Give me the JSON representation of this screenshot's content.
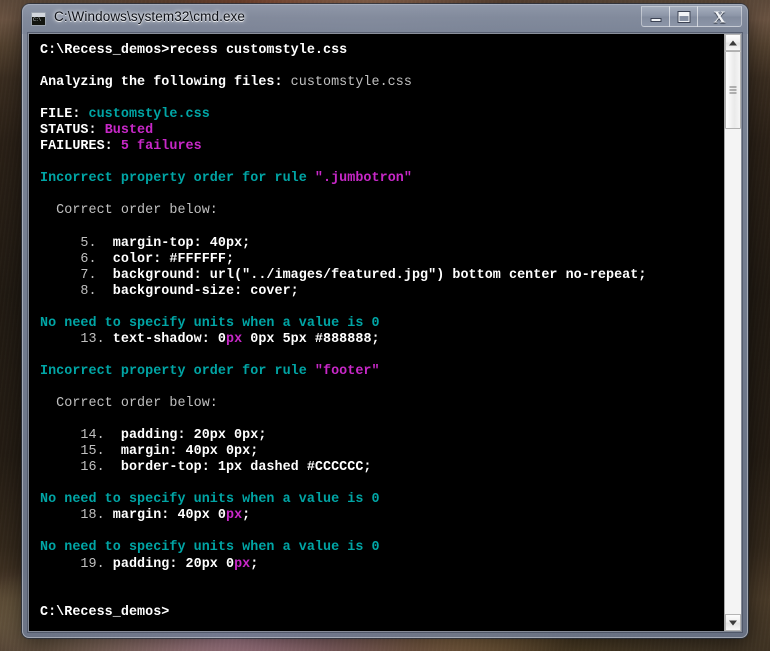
{
  "desktop": {
    "wallpaper_alt": "blurred photograph wallpaper"
  },
  "window": {
    "title": "C:\\Windows\\system32\\cmd.exe",
    "icon_name": "cmd-console-icon",
    "icon_label": "C:\\",
    "buttons": {
      "minimize": "Minimize",
      "maximize": "Maximize",
      "close": "Close"
    }
  },
  "scrollbar": {
    "up_arrow": "Scroll up",
    "down_arrow": "Scroll down",
    "thumb": "Scroll thumb"
  },
  "console": {
    "lines": [
      {
        "id": "prompt-1",
        "segments": [
          {
            "text": "C:\\Recess_demos>recess customstyle.css",
            "color": "white"
          }
        ]
      },
      {
        "id": "blank-1",
        "segments": [
          {
            "text": "",
            "color": "white"
          }
        ]
      },
      {
        "id": "analyzing",
        "segments": [
          {
            "text": "Analyzing the following files: ",
            "color": "white"
          },
          {
            "text": "customstyle.css",
            "color": "gray"
          }
        ]
      },
      {
        "id": "blank-2",
        "segments": [
          {
            "text": "",
            "color": "white"
          }
        ]
      },
      {
        "id": "file",
        "segments": [
          {
            "text": "FILE: ",
            "color": "white"
          },
          {
            "text": "customstyle.css",
            "color": "cyan"
          }
        ]
      },
      {
        "id": "status",
        "segments": [
          {
            "text": "STATUS: ",
            "color": "white"
          },
          {
            "text": "Busted",
            "color": "magenta"
          }
        ]
      },
      {
        "id": "failures",
        "segments": [
          {
            "text": "FAILURES: ",
            "color": "white"
          },
          {
            "text": "5 failures",
            "color": "magenta"
          }
        ]
      },
      {
        "id": "blank-3",
        "segments": [
          {
            "text": "",
            "color": "white"
          }
        ]
      },
      {
        "id": "error-1",
        "segments": [
          {
            "text": "Incorrect property order for rule ",
            "color": "cyan"
          },
          {
            "text": "\".jumbotron\"",
            "color": "magenta"
          }
        ]
      },
      {
        "id": "blank-4",
        "segments": [
          {
            "text": "",
            "color": "white"
          }
        ]
      },
      {
        "id": "correct-order-1",
        "segments": [
          {
            "text": "  Correct order below:",
            "color": "gray"
          }
        ]
      },
      {
        "id": "blank-5",
        "segments": [
          {
            "text": "",
            "color": "white"
          }
        ]
      },
      {
        "id": "rule-5",
        "segments": [
          {
            "text": "     5.  ",
            "color": "gray"
          },
          {
            "text": "margin-top: 40px;",
            "color": "white"
          }
        ]
      },
      {
        "id": "rule-6",
        "segments": [
          {
            "text": "     6.  ",
            "color": "gray"
          },
          {
            "text": "color: #FFFFFF;",
            "color": "white"
          }
        ]
      },
      {
        "id": "rule-7",
        "segments": [
          {
            "text": "     7.  ",
            "color": "gray"
          },
          {
            "text": "background: url(\"../images/featured.jpg\") bottom center no-repeat;",
            "color": "white"
          }
        ]
      },
      {
        "id": "rule-8",
        "segments": [
          {
            "text": "     8.  ",
            "color": "gray"
          },
          {
            "text": "background-size: cover;",
            "color": "white"
          }
        ]
      },
      {
        "id": "blank-6",
        "segments": [
          {
            "text": "",
            "color": "white"
          }
        ]
      },
      {
        "id": "error-2",
        "segments": [
          {
            "text": "No need to specify units when a value is 0",
            "color": "cyan"
          }
        ]
      },
      {
        "id": "rule-13",
        "segments": [
          {
            "text": "     13. ",
            "color": "gray"
          },
          {
            "text": "text-shadow: 0",
            "color": "white"
          },
          {
            "text": "px",
            "color": "magenta"
          },
          {
            "text": " 0px 5px #888888;",
            "color": "white"
          }
        ]
      },
      {
        "id": "blank-7",
        "segments": [
          {
            "text": "",
            "color": "white"
          }
        ]
      },
      {
        "id": "error-3",
        "segments": [
          {
            "text": "Incorrect property order for rule ",
            "color": "cyan"
          },
          {
            "text": "\"footer\"",
            "color": "magenta"
          }
        ]
      },
      {
        "id": "blank-8",
        "segments": [
          {
            "text": "",
            "color": "white"
          }
        ]
      },
      {
        "id": "correct-order-2",
        "segments": [
          {
            "text": "  Correct order below:",
            "color": "gray"
          }
        ]
      },
      {
        "id": "blank-9",
        "segments": [
          {
            "text": "",
            "color": "white"
          }
        ]
      },
      {
        "id": "rule-14",
        "segments": [
          {
            "text": "     14.  ",
            "color": "gray"
          },
          {
            "text": "padding: 20px 0px;",
            "color": "white"
          }
        ]
      },
      {
        "id": "rule-15",
        "segments": [
          {
            "text": "     15.  ",
            "color": "gray"
          },
          {
            "text": "margin: 40px 0px;",
            "color": "white"
          }
        ]
      },
      {
        "id": "rule-16",
        "segments": [
          {
            "text": "     16.  ",
            "color": "gray"
          },
          {
            "text": "border-top: 1px dashed #CCCCCC;",
            "color": "white"
          }
        ]
      },
      {
        "id": "blank-10",
        "segments": [
          {
            "text": "",
            "color": "white"
          }
        ]
      },
      {
        "id": "error-4",
        "segments": [
          {
            "text": "No need to specify units when a value is 0",
            "color": "cyan"
          }
        ]
      },
      {
        "id": "rule-18",
        "segments": [
          {
            "text": "     18. ",
            "color": "gray"
          },
          {
            "text": "margin: 40px 0",
            "color": "white"
          },
          {
            "text": "px",
            "color": "magenta"
          },
          {
            "text": ";",
            "color": "white"
          }
        ]
      },
      {
        "id": "blank-11",
        "segments": [
          {
            "text": "",
            "color": "white"
          }
        ]
      },
      {
        "id": "error-5",
        "segments": [
          {
            "text": "No need to specify units when a value is 0",
            "color": "cyan"
          }
        ]
      },
      {
        "id": "rule-19",
        "segments": [
          {
            "text": "     19. ",
            "color": "gray"
          },
          {
            "text": "padding: 20px 0",
            "color": "white"
          },
          {
            "text": "px",
            "color": "magenta"
          },
          {
            "text": ";",
            "color": "white"
          }
        ]
      },
      {
        "id": "blank-12",
        "segments": [
          {
            "text": "",
            "color": "white"
          }
        ]
      },
      {
        "id": "blank-13",
        "segments": [
          {
            "text": "",
            "color": "white"
          }
        ]
      },
      {
        "id": "prompt-2",
        "segments": [
          {
            "text": "C:\\Recess_demos>",
            "color": "white"
          }
        ]
      }
    ]
  },
  "colors": {
    "background": "#000000",
    "white": "#ffffff",
    "gray": "#c0c0c0",
    "cyan": "#00a5a5",
    "magenta": "#c828c8",
    "frame": "#838da0"
  }
}
